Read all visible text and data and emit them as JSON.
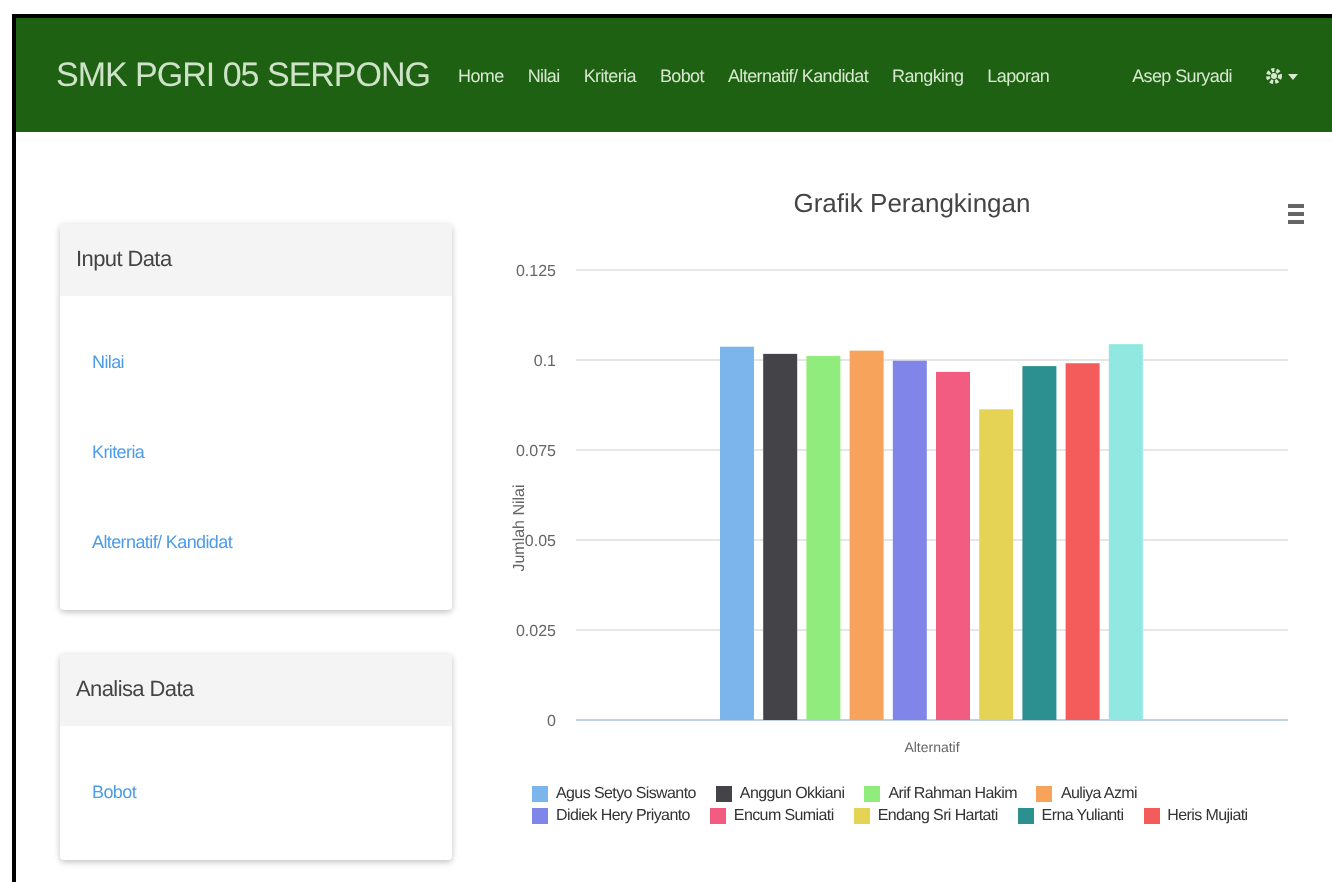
{
  "navbar": {
    "brand": "SMK PGRI 05 SERPONG",
    "links": [
      "Home",
      "Nilai",
      "Kriteria",
      "Bobot",
      "Alternatif/ Kandidat",
      "Rangking",
      "Laporan"
    ],
    "user": "Asep Suryadi"
  },
  "sidebar": [
    {
      "title": "Input Data",
      "items": [
        "Nilai",
        "Kriteria",
        "Alternatif/ Kandidat"
      ]
    },
    {
      "title": "Analisa Data",
      "items": [
        "Bobot"
      ]
    }
  ],
  "chart": {
    "chart_data": {
      "type": "bar",
      "title": "Grafik Perangkingan",
      "xlabel": "Alternatif",
      "ylabel": "Jumlah Nilai",
      "grid": true,
      "legend": "bottom",
      "ylim": [
        0,
        0.125
      ],
      "yticks": [
        0,
        0.025,
        0.05,
        0.075,
        0.1,
        0.125
      ],
      "series": [
        {
          "name": "Agus Setyo Siswanto",
          "color": "#7cb5ec",
          "values": [
            0.1037
          ]
        },
        {
          "name": "Anggun Okkiani",
          "color": "#434348",
          "values": [
            0.1017
          ]
        },
        {
          "name": "Arif Rahman Hakim",
          "color": "#90ed7d",
          "values": [
            0.1011
          ]
        },
        {
          "name": "Auliya Azmi",
          "color": "#f7a35c",
          "values": [
            0.1026
          ]
        },
        {
          "name": "Didiek Hery Priyanto",
          "color": "#8085e9",
          "values": [
            0.0998
          ]
        },
        {
          "name": "Encum Sumiati",
          "color": "#f15c80",
          "values": [
            0.0967
          ]
        },
        {
          "name": "Endang Sri Hartati",
          "color": "#e4d354",
          "values": [
            0.0863
          ]
        },
        {
          "name": "Erna Yulianti",
          "color": "#2b908f",
          "values": [
            0.0983
          ]
        },
        {
          "name": "Heris Mujiati",
          "color": "#f45b5b",
          "values": [
            0.0991
          ]
        },
        {
          "color": "#91e8e1",
          "values": [
            0.1044
          ]
        }
      ]
    }
  }
}
